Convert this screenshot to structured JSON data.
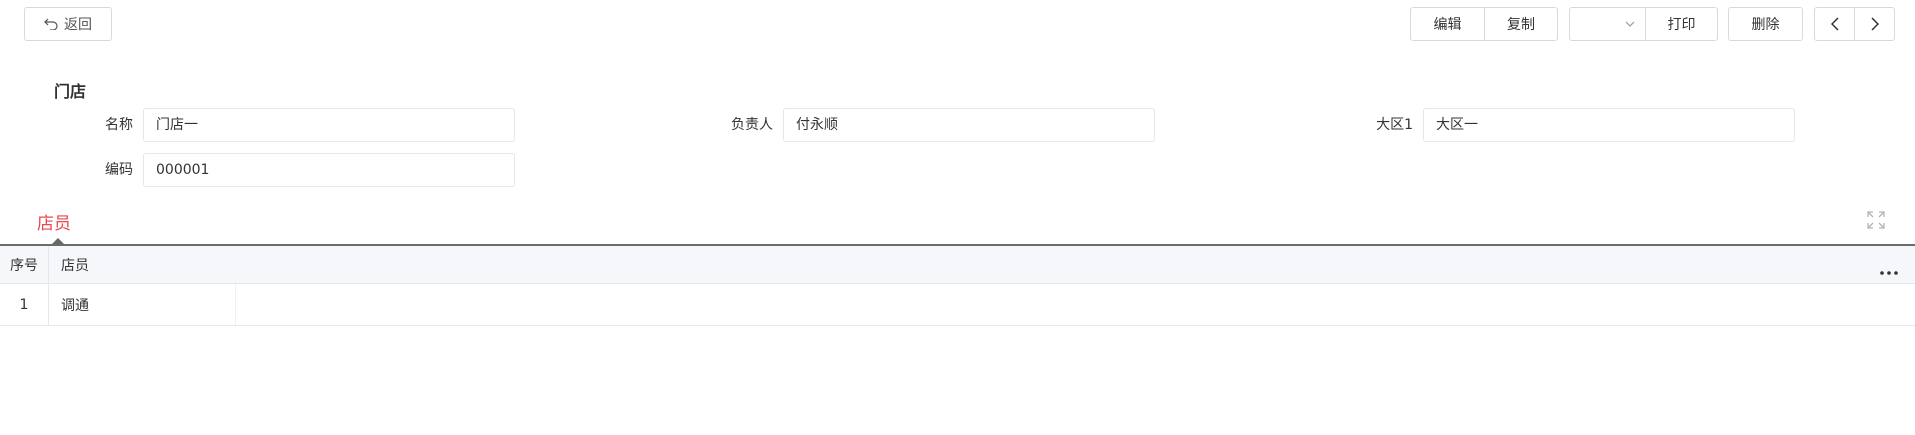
{
  "toolbar": {
    "back_label": "返回",
    "edit_label": "编辑",
    "copy_label": "复制",
    "print_select_value": "",
    "print_label": "打印",
    "delete_label": "删除"
  },
  "form": {
    "section_title": "门店",
    "fields": [
      {
        "label": "名称",
        "value": "门店一"
      },
      {
        "label": "负责人",
        "value": "付永顺"
      },
      {
        "label": "大区1",
        "value": "大区一"
      },
      {
        "label": "编码",
        "value": "000001"
      }
    ]
  },
  "tabs": [
    {
      "label": "店员",
      "active": true
    }
  ],
  "grid": {
    "columns": [
      "序号",
      "店员"
    ],
    "rows": [
      {
        "index": "1",
        "name": "调通"
      }
    ]
  },
  "colors": {
    "accent": "#e5484d",
    "border": "#d9d9d9",
    "header_bg": "#f5f7fa"
  }
}
